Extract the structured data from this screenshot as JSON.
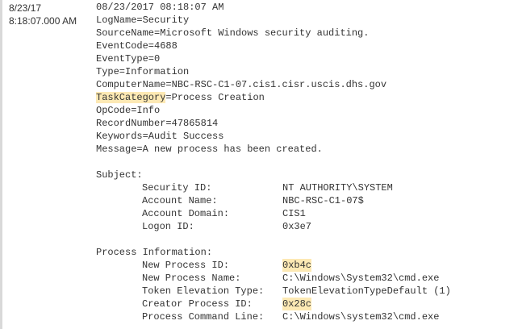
{
  "timestamp": {
    "date": "8/23/17",
    "time": "8:18:07.000 AM"
  },
  "event": {
    "header": "08/23/2017 08:18:07 AM",
    "fields": {
      "logname": "LogName=Security",
      "sourcename": "SourceName=Microsoft Windows security auditing.",
      "eventcode": "EventCode=4688",
      "eventtype": "EventType=0",
      "type": "Type=Information",
      "computername": "ComputerName=NBC-RSC-C1-07.cis1.cisr.uscis.dhs.gov",
      "taskcategory_key": "TaskCategory",
      "taskcategory_rest": "=Process Creation",
      "opcode": "OpCode=Info",
      "recordnumber": "RecordNumber=47865814",
      "keywords": "Keywords=Audit Success",
      "message": "Message=A new process has been created."
    },
    "subject": {
      "title": "Subject:",
      "rows": [
        {
          "label": "Security ID:",
          "value": "NT AUTHORITY\\SYSTEM"
        },
        {
          "label": "Account Name:",
          "value": "NBC-RSC-C1-07$"
        },
        {
          "label": "Account Domain:",
          "value": "CIS1"
        },
        {
          "label": "Logon ID:",
          "value": "0x3e7"
        }
      ]
    },
    "process": {
      "title": "Process Information:",
      "rows": [
        {
          "label": "New Process ID:",
          "value": "0xb4c",
          "highlight": true
        },
        {
          "label": "New Process Name:",
          "value": "C:\\Windows\\System32\\cmd.exe"
        },
        {
          "label": "Token Elevation Type:",
          "value": "TokenElevationTypeDefault (1)"
        },
        {
          "label": "Creator Process ID:",
          "value": "0x28c",
          "highlight": true
        },
        {
          "label": "Process Command Line:",
          "value": "C:\\Windows\\system32\\cmd.exe"
        }
      ]
    }
  },
  "colors": {
    "highlight": "#fde9b4",
    "text": "#333333",
    "left_bar": "#d9d9d9"
  }
}
